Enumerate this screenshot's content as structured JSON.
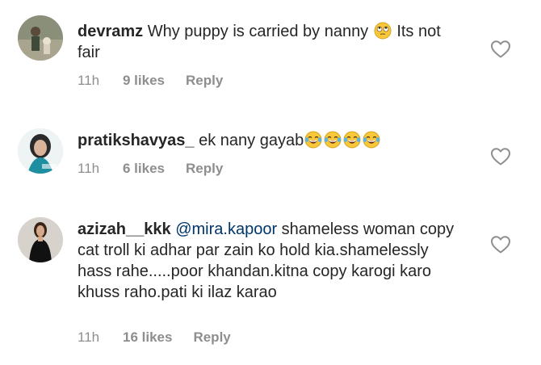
{
  "comments": [
    {
      "username": "devramz",
      "text_before": "Why puppy is carried by nanny",
      "emojis": [
        "rolling-eyes"
      ],
      "text_after": "Its not fair",
      "time": "11h",
      "likes": "9 likes",
      "reply": "Reply"
    },
    {
      "username": "pratikshavyas_",
      "text_before": "ek nany gayab",
      "emojis": [
        "laugh-cry",
        "laugh-cry",
        "laugh-cry",
        "laugh-cry"
      ],
      "time": "11h",
      "likes": "6 likes",
      "reply": "Reply"
    },
    {
      "username": "azizah__kkk",
      "mention": "@mira.kapoor",
      "text_after": "shameless woman copy cat troll ki adhar par zain ko hold kia.shamelessly hass rahe.....poor khandan.kitna copy karogi karo khuss raho.pati ki ilaz karao",
      "time": "11h",
      "likes": "16 likes",
      "reply": "Reply"
    }
  ],
  "colors": {
    "text": "#262626",
    "meta": "#8e8e8e",
    "mention": "#003569"
  },
  "icons": {
    "like": "heart-outline-icon",
    "emoji_rolling_eyes": "rolling-eyes-emoji",
    "emoji_laugh": "face-with-tears-of-joy-emoji"
  }
}
